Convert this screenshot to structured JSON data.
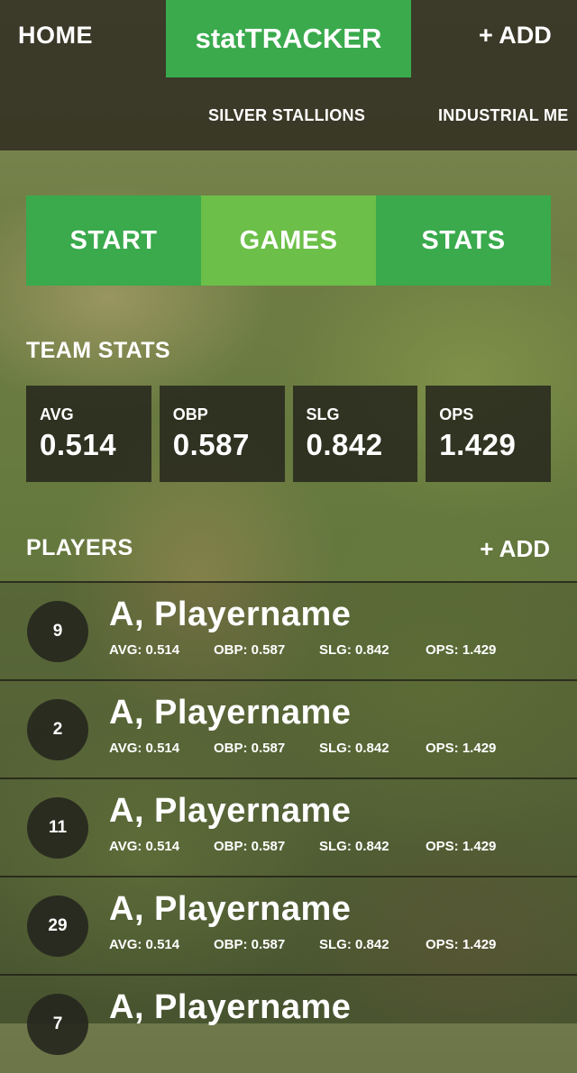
{
  "nav": {
    "home_label": "HOME",
    "brand": "statTRACKER",
    "add_label": "+ ADD",
    "teams": [
      "SILVER STALLIONS",
      "INDUSTRIAL ME"
    ]
  },
  "tabs": [
    {
      "label": "START",
      "active": false
    },
    {
      "label": "GAMES",
      "active": true
    },
    {
      "label": "STATS",
      "active": false
    }
  ],
  "team_stats": {
    "title": "TEAM STATS",
    "items": [
      {
        "label": "AVG",
        "value": "0.514"
      },
      {
        "label": "OBP",
        "value": "0.587"
      },
      {
        "label": "SLG",
        "value": "0.842"
      },
      {
        "label": "OPS",
        "value": "1.429"
      }
    ]
  },
  "players": {
    "title": "PLAYERS",
    "add_label": "+ ADD",
    "rows": [
      {
        "number": "9",
        "name": "A, Playername",
        "avg": "AVG: 0.514",
        "obp": "OBP: 0.587",
        "slg": "SLG: 0.842",
        "ops": "OPS: 1.429"
      },
      {
        "number": "2",
        "name": "A, Playername",
        "avg": "AVG: 0.514",
        "obp": "OBP: 0.587",
        "slg": "SLG: 0.842",
        "ops": "OPS: 1.429"
      },
      {
        "number": "11",
        "name": "A, Playername",
        "avg": "AVG: 0.514",
        "obp": "OBP: 0.587",
        "slg": "SLG: 0.842",
        "ops": "OPS: 1.429"
      },
      {
        "number": "29",
        "name": "A, Playername",
        "avg": "AVG: 0.514",
        "obp": "OBP: 0.587",
        "slg": "SLG: 0.842",
        "ops": "OPS: 1.429"
      },
      {
        "number": "7",
        "name": "A, Playername",
        "avg": "",
        "obp": "",
        "slg": "",
        "ops": ""
      }
    ]
  },
  "colors": {
    "accent_green": "#3aaa4d",
    "active_tab_green": "#6cbf48",
    "card_dark": "#26261c"
  }
}
